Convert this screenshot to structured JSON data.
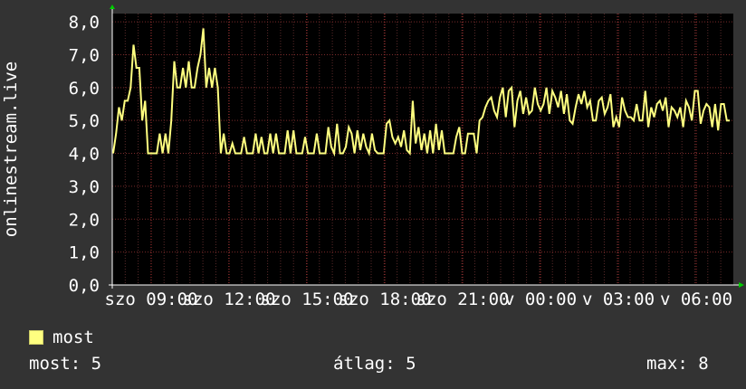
{
  "chart_data": {
    "type": "line",
    "ylabel": "onlinestream.live",
    "ylim": [
      0,
      8.25
    ],
    "y_ticks": [
      "0,0",
      "1,0",
      "2,0",
      "3,0",
      "4,0",
      "5,0",
      "6,0",
      "7,0",
      "8,0"
    ],
    "x_ticks": [
      "szo 09:00",
      "szo 12:00",
      "szo 15:00",
      "szo 18:00",
      "szo 21:00",
      "v 00:00",
      "v 03:00",
      "v 06:00"
    ],
    "grid": true,
    "legend_position": "bottom-left",
    "series": [
      {
        "name": "most",
        "color": "#ffff80",
        "values": [
          4,
          4.6,
          5.4,
          5,
          5.6,
          5.6,
          6,
          7.3,
          6.6,
          6.6,
          5,
          5.6,
          4,
          4,
          4,
          4,
          4.6,
          4,
          4.6,
          4,
          5,
          6.8,
          6,
          6,
          6.6,
          6,
          6.8,
          6,
          6,
          6.6,
          7,
          7.8,
          6,
          6.6,
          6,
          6.6,
          6,
          4,
          4.6,
          4,
          4,
          4.3,
          4,
          4,
          4,
          4.5,
          4,
          4,
          4,
          4.6,
          4,
          4.5,
          4,
          4,
          4.6,
          4,
          4.6,
          4,
          4,
          4,
          4.7,
          4,
          4.7,
          4,
          4,
          4,
          4.5,
          4,
          4,
          4,
          4.6,
          4,
          4,
          4,
          4.8,
          4.2,
          4,
          4.9,
          4,
          4,
          4.2,
          4.8,
          4.6,
          4,
          4.7,
          4.1,
          4.6,
          4.2,
          4,
          4.6,
          4.1,
          4,
          4,
          4,
          4.9,
          5,
          4.5,
          4.3,
          4.5,
          4.2,
          4.7,
          4.1,
          4,
          5.6,
          4.3,
          4.8,
          4.1,
          4.6,
          4,
          4.7,
          4,
          4.9,
          4.1,
          4.7,
          4,
          4,
          4,
          4,
          4.5,
          4.8,
          4,
          4,
          4.6,
          4.6,
          4.6,
          4,
          5,
          5.1,
          5.4,
          5.6,
          5.7,
          5.3,
          5.1,
          5.7,
          6,
          5.1,
          5.9,
          6,
          4.8,
          5.6,
          5.9,
          5.2,
          5.7,
          5.2,
          5.3,
          6,
          5.5,
          5.3,
          5.5,
          6,
          5.2,
          5.9,
          5.7,
          5.4,
          5.9,
          5.2,
          5.8,
          5,
          4.9,
          5.4,
          5.8,
          5.5,
          5.9,
          5.4,
          5.6,
          5,
          5,
          5.6,
          5.7,
          5.2,
          5.4,
          5.8,
          4.8,
          5.1,
          4.8,
          5.7,
          5.3,
          5.1,
          5.1,
          5,
          5.5,
          5,
          5,
          5.9,
          4.8,
          5.4,
          5.1,
          5.5,
          5.6,
          5.3,
          5.7,
          4.8,
          5.4,
          5.3,
          5.1,
          5.4,
          4.8,
          5.6,
          5.4,
          5,
          5.9,
          5.9,
          4.9,
          5.3,
          5.5,
          5.4,
          4.8,
          5.5,
          4.7,
          5.5,
          5.5,
          5,
          5
        ]
      }
    ]
  },
  "legend": {
    "label": "most",
    "color": "#ffff80"
  },
  "stats": {
    "current": "most: 5",
    "average": "átlag: 5",
    "max": "max: 8"
  }
}
